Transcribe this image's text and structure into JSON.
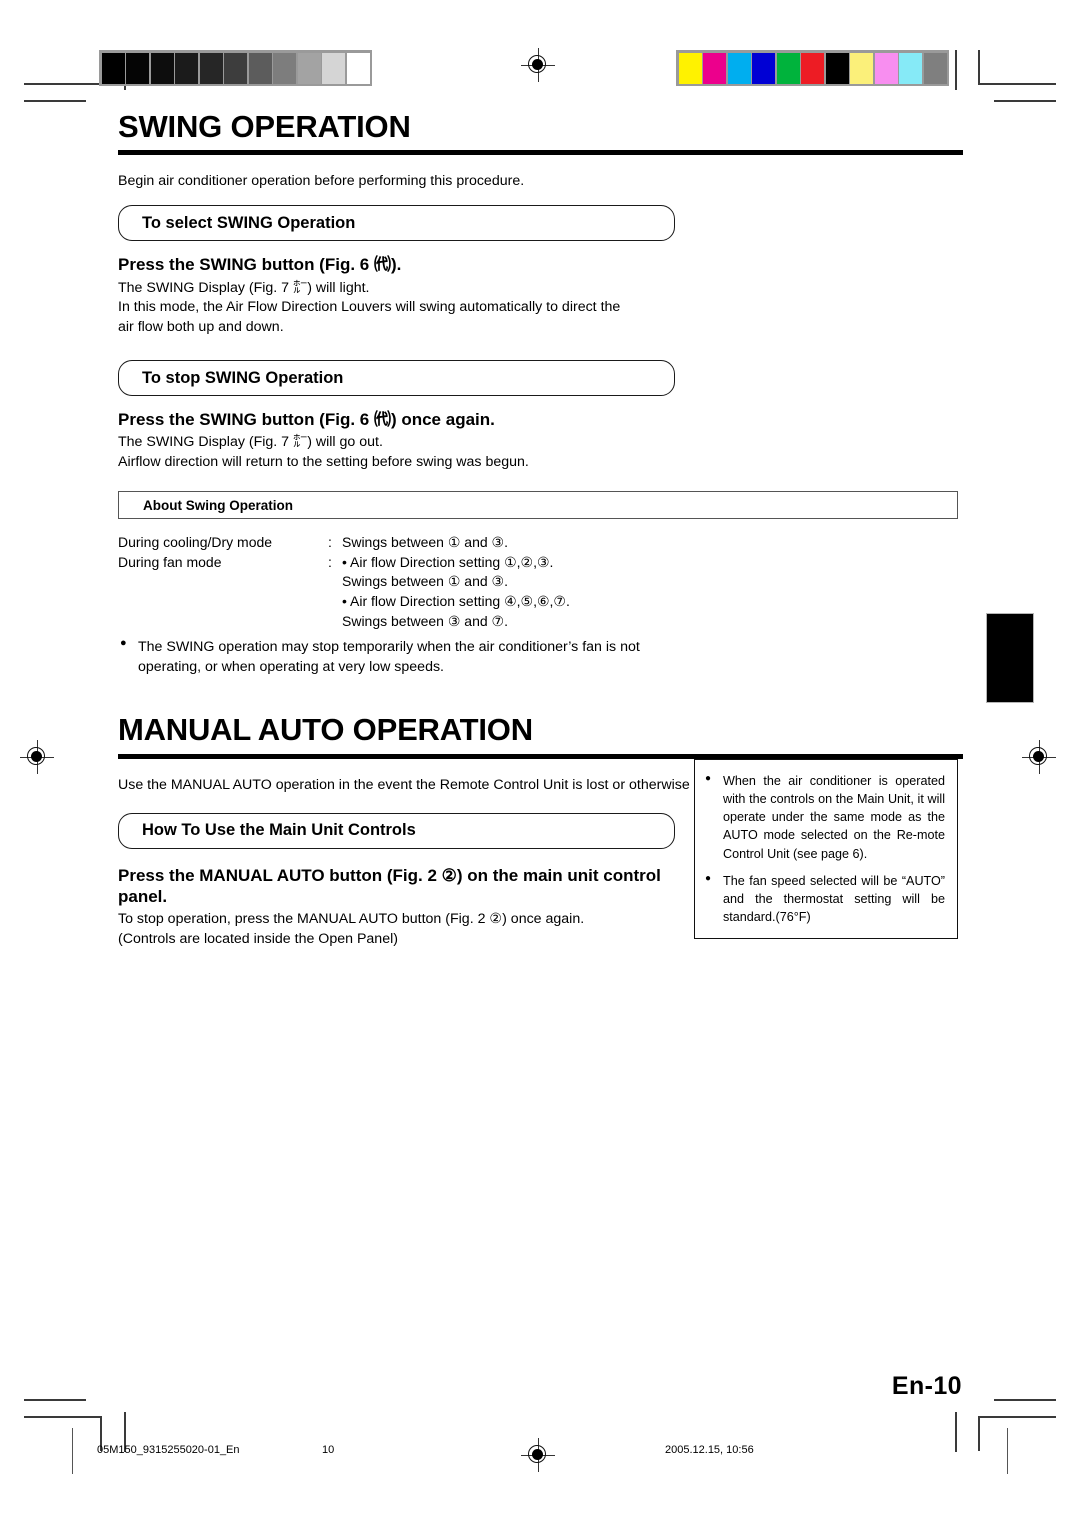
{
  "document": {
    "page_number_label": "En-10"
  },
  "sections": [
    {
      "id": "swing",
      "title": "SWING OPERATION",
      "intro": "Begin air conditioner operation before performing this procedure.",
      "blocks": [
        {
          "pill": "To select SWING Operation",
          "step": "Press the SWING button (Fig. 6 ㈹).",
          "lines": [
            "The SWING Display (Fig. 7 ㍁) will light.",
            "In this mode, the Air Flow Direction Louvers will swing automatically to direct the",
            "air flow both up and down."
          ]
        },
        {
          "pill": "To stop SWING Operation",
          "step": "Press the SWING button (Fig. 6 ㈹) once again.",
          "lines": [
            "The SWING Display (Fig. 7 ㍁) will go out.",
            "Airflow direction will return to the setting before swing was begun."
          ]
        }
      ],
      "about": {
        "heading": "About Swing Operation",
        "rows": [
          {
            "label": "During cooling/Dry mode",
            "colon": ":",
            "lines": [
              "Swings between ① and ③."
            ]
          },
          {
            "label": "During fan mode",
            "colon": ":",
            "lines": [
              "• Air flow Direction setting ①,②,③.",
              "Swings between ① and ③.",
              "• Air flow Direction setting ④,⑤,⑥,⑦.",
              "Swings between ③ and ⑦."
            ]
          }
        ],
        "bullets": [
          {
            "line1": "The SWING operation may stop temporarily when the air conditioner’s fan is not",
            "line2": "operating, or when operating at very low speeds."
          }
        ]
      }
    },
    {
      "id": "manual-auto",
      "title": "MANUAL AUTO OPERATION",
      "intro": "Use the MANUAL AUTO operation in the event the Remote Control Unit is lost or otherwise unavailable.",
      "blocks": [
        {
          "pill": "How To Use the Main Unit Controls",
          "step": "Press the MANUAL AUTO button  (Fig. 2 ②) on the main unit control panel.",
          "lines": [
            "To stop operation, press the MANUAL AUTO button (Fig. 2 ②) once again.",
            "(Controls are located inside the Open Panel)"
          ]
        }
      ]
    }
  ],
  "note_box": {
    "items": [
      "When the air conditioner is operated with the controls on the Main Unit, it will operate under the same mode as the AUTO mode selected on the Re-mote Control Unit (see page 6).",
      "The fan speed selected will be “AUTO” and the thermostat setting will be standard.(76°F)"
    ]
  },
  "footer": {
    "file_id": "05M150_9315255020-01_En",
    "page": "10",
    "timestamp": "2005.12.15, 10:56"
  },
  "print_marks": {
    "grayscale_patches": [
      "#000000",
      "#050505",
      "#0d0d0d",
      "#1b1b1b",
      "#262626",
      "#3d3d3d",
      "#5c5c5c",
      "#7d7d7d",
      "#a3a3a3",
      "#d5d5d5",
      "#ffffff"
    ],
    "color_patches": [
      "#fff200",
      "#ec008c",
      "#00aeef",
      "#0000d4",
      "#00b33c",
      "#ed1c24",
      "#000000",
      "#fbf07a",
      "#f88ef0",
      "#86eaf7",
      "#7f7f7f"
    ]
  }
}
